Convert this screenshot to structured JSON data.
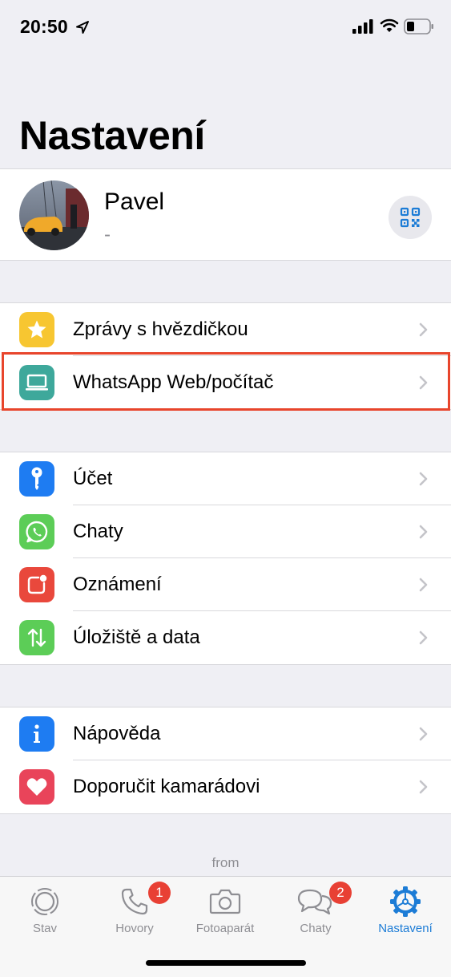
{
  "status_bar": {
    "time": "20:50"
  },
  "page": {
    "title": "Nastavení"
  },
  "profile": {
    "name": "Pavel",
    "status": "-"
  },
  "group1": [
    {
      "label": "Zprávy s hvězdičkou",
      "icon": "star-icon",
      "color": "#f7c631"
    },
    {
      "label": "WhatsApp Web/počítač",
      "icon": "laptop-icon",
      "color": "#3ea89b"
    }
  ],
  "group2": [
    {
      "label": "Účet",
      "icon": "key-icon",
      "color": "#1e7cf2"
    },
    {
      "label": "Chaty",
      "icon": "whatsapp-icon",
      "color": "#5ccd57"
    },
    {
      "label": "Oznámení",
      "icon": "notification-icon",
      "color": "#e9483c"
    },
    {
      "label": "Úložiště a data",
      "icon": "arrows-updown-icon",
      "color": "#5ccd57"
    }
  ],
  "group3": [
    {
      "label": "Nápověda",
      "icon": "info-icon",
      "color": "#1e7cf2"
    },
    {
      "label": "Doporučit kamarádovi",
      "icon": "heart-icon",
      "color": "#e9445a"
    }
  ],
  "footer": {
    "from": "from"
  },
  "tabs": [
    {
      "label": "Stav",
      "icon": "status-icon"
    },
    {
      "label": "Hovory",
      "icon": "phone-icon",
      "badge": "1"
    },
    {
      "label": "Fotoaparát",
      "icon": "camera-icon"
    },
    {
      "label": "Chaty",
      "icon": "chats-icon",
      "badge": "2"
    },
    {
      "label": "Nastavení",
      "icon": "settings-gear-icon",
      "active": true
    }
  ],
  "colors": {
    "accent": "#1c7cd6",
    "highlight": "#e8452c",
    "badge": "#e84034"
  }
}
